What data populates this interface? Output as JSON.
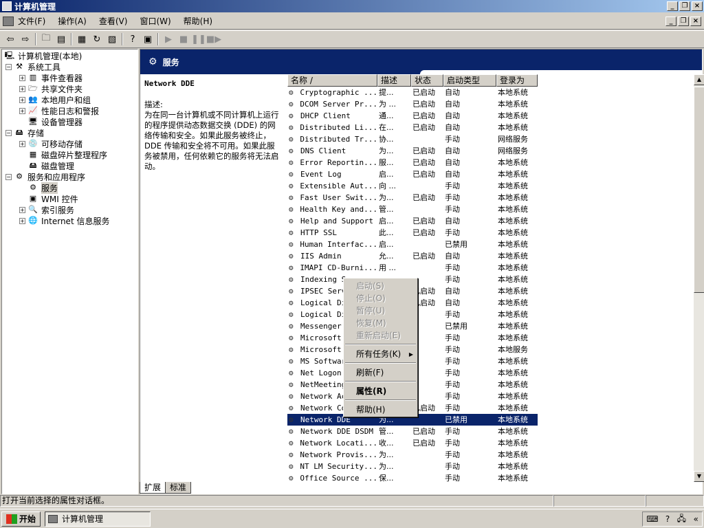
{
  "window": {
    "title": "计算机管理"
  },
  "menu": [
    "文件(F)",
    "操作(A)",
    "查看(V)",
    "窗口(W)",
    "帮助(H)"
  ],
  "tree": {
    "root": "计算机管理(本地)",
    "system_tools": "系统工具",
    "event_viewer": "事件查看器",
    "shared_folders": "共享文件夹",
    "local_users": "本地用户和组",
    "perf_logs": "性能日志和警报",
    "device_manager": "设备管理器",
    "storage": "存储",
    "removable": "可移动存储",
    "defrag": "磁盘碎片整理程序",
    "disk_mgmt": "磁盘管理",
    "services_apps": "服务和应用程序",
    "services": "服务",
    "wmi": "WMI 控件",
    "indexing": "索引服务",
    "iis": "Internet 信息服务"
  },
  "header": {
    "title": "服务"
  },
  "description": {
    "service_name": "Network DDE",
    "label": "描述:",
    "text": "为在同一台计算机或不同计算机上运行的程序提供动态数据交换 (DDE) 的网络传输和安全。如果此服务被终止， DDE 传输和安全将不可用。如果此服务被禁用，任何依赖它的服务将无法启动。"
  },
  "columns": [
    "名称 /",
    "描述",
    "状态",
    "启动类型",
    "登录为"
  ],
  "services": [
    [
      "Cryptographic ...",
      "提...",
      "已启动",
      "自动",
      "本地系统"
    ],
    [
      "DCOM Server Pr...",
      "为 ...",
      "已启动",
      "自动",
      "本地系统"
    ],
    [
      "DHCP Client",
      "通...",
      "已启动",
      "自动",
      "本地系统"
    ],
    [
      "Distributed Li...",
      "在...",
      "已启动",
      "自动",
      "本地系统"
    ],
    [
      "Distributed Tr...",
      "协...",
      "",
      "手动",
      "网络服务"
    ],
    [
      "DNS Client",
      "为...",
      "已启动",
      "自动",
      "网络服务"
    ],
    [
      "Error Reportin...",
      "服...",
      "已启动",
      "自动",
      "本地系统"
    ],
    [
      "Event Log",
      "启...",
      "已启动",
      "自动",
      "本地系统"
    ],
    [
      "Extensible Aut...",
      "向 ...",
      "",
      "手动",
      "本地系统"
    ],
    [
      "Fast User Swit...",
      "为...",
      "已启动",
      "手动",
      "本地系统"
    ],
    [
      "Health Key and...",
      "管...",
      "",
      "手动",
      "本地系统"
    ],
    [
      "Help and Support",
      "启...",
      "已启动",
      "自动",
      "本地系统"
    ],
    [
      "HTTP SSL",
      "此...",
      "已启动",
      "手动",
      "本地系统"
    ],
    [
      "Human Interfac...",
      "启...",
      "",
      "已禁用",
      "本地系统"
    ],
    [
      "IIS Admin",
      "允...",
      "已启动",
      "自动",
      "本地系统"
    ],
    [
      "IMAPI CD-Burni...",
      "用 ...",
      "",
      "手动",
      "本地系统"
    ],
    [
      "Indexing S",
      "",
      "",
      " 手动",
      "本地系统"
    ],
    [
      "IPSEC Serv",
      "",
      "已启动",
      "自动",
      "本地系统"
    ],
    [
      "Logical Di",
      "",
      "已启动",
      "自动",
      "本地系统"
    ],
    [
      "Logical Di",
      "",
      "",
      "手动",
      "本地系统"
    ],
    [
      "Messenger",
      "",
      "",
      "已禁用",
      "本地系统"
    ],
    [
      "Microsoft",
      "",
      "",
      "手动",
      "本地系统"
    ],
    [
      "Microsoft",
      "",
      "",
      "手动",
      "本地服务"
    ],
    [
      "MS Softwar",
      "",
      "",
      "手动",
      "本地系统"
    ],
    [
      "Net Logon",
      "",
      "",
      "手动",
      "本地系统"
    ],
    [
      "NetMeeting",
      "",
      "",
      "手动",
      "本地系统"
    ],
    [
      "Network Ac",
      "",
      "",
      "手动",
      "本地系统"
    ],
    [
      "Network Co",
      "",
      "已启动",
      "手动",
      "本地系统"
    ],
    [
      "Network DDE",
      "为...",
      "",
      "已禁用",
      "本地系统"
    ],
    [
      "Network DDE DSDM",
      "管...",
      "已启动",
      "手动",
      "本地系统"
    ],
    [
      "Network Locati...",
      "收...",
      "已启动",
      "手动",
      "本地系统"
    ],
    [
      "Network Provis...",
      "为...",
      "",
      "手动",
      "本地系统"
    ],
    [
      "NT LM Security...",
      "为...",
      "",
      "手动",
      "本地系统"
    ],
    [
      "Office Source ...",
      "保...",
      "",
      "手动",
      "本地系统"
    ]
  ],
  "tabs": [
    "扩展",
    "标准"
  ],
  "context_menu": {
    "start": "启动(S)",
    "stop": "停止(O)",
    "pause": "暂停(U)",
    "resume": "恢复(M)",
    "restart": "重新启动(E)",
    "all_tasks": "所有任务(K)",
    "refresh": "刷新(F)",
    "properties": "属性(R)",
    "help": "帮助(H)"
  },
  "status": {
    "text": "打开当前选择的属性对话框。"
  },
  "taskbar": {
    "start": "开始",
    "task": "计算机管理",
    "clock": "?"
  }
}
